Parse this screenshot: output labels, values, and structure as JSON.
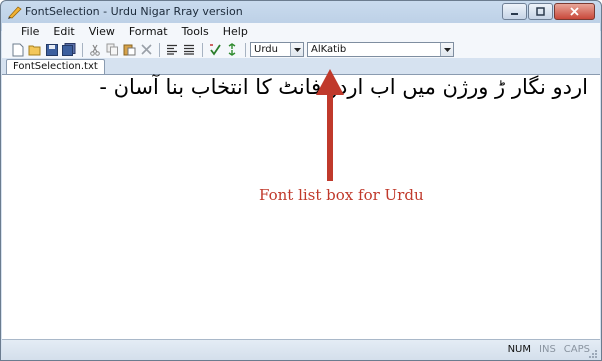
{
  "window": {
    "title": "FontSelection - Urdu Nigar Rray version"
  },
  "menu": [
    "File",
    "Edit",
    "View",
    "Format",
    "Tools",
    "Help"
  ],
  "toolbar": {
    "icons": [
      "new-file-icon",
      "open-folder-icon",
      "save-icon",
      "save-all-icon",
      "cut-icon",
      "copy-icon",
      "paste-icon",
      "delete-icon",
      "align-left-icon",
      "align-justify-icon",
      "spell-check-icon",
      "refresh-icon"
    ],
    "language_value": "Urdu",
    "font_value": "AlKatib"
  },
  "tab": {
    "label": "FontSelection.txt"
  },
  "editor": {
    "text": "اردو نگار ڑ ورژن میں اب اردو فانٹ کا انتخاب بنا آسان -"
  },
  "annotation": {
    "label": "Font list box for Urdu",
    "color": "#c0392b"
  },
  "status": {
    "num": "NUM",
    "ins": "INS",
    "caps": "CAPS"
  },
  "colors": {
    "title_gradient_top": "#c9dbee",
    "window_border": "#6b7c8f",
    "close_button": "#c9483a"
  }
}
